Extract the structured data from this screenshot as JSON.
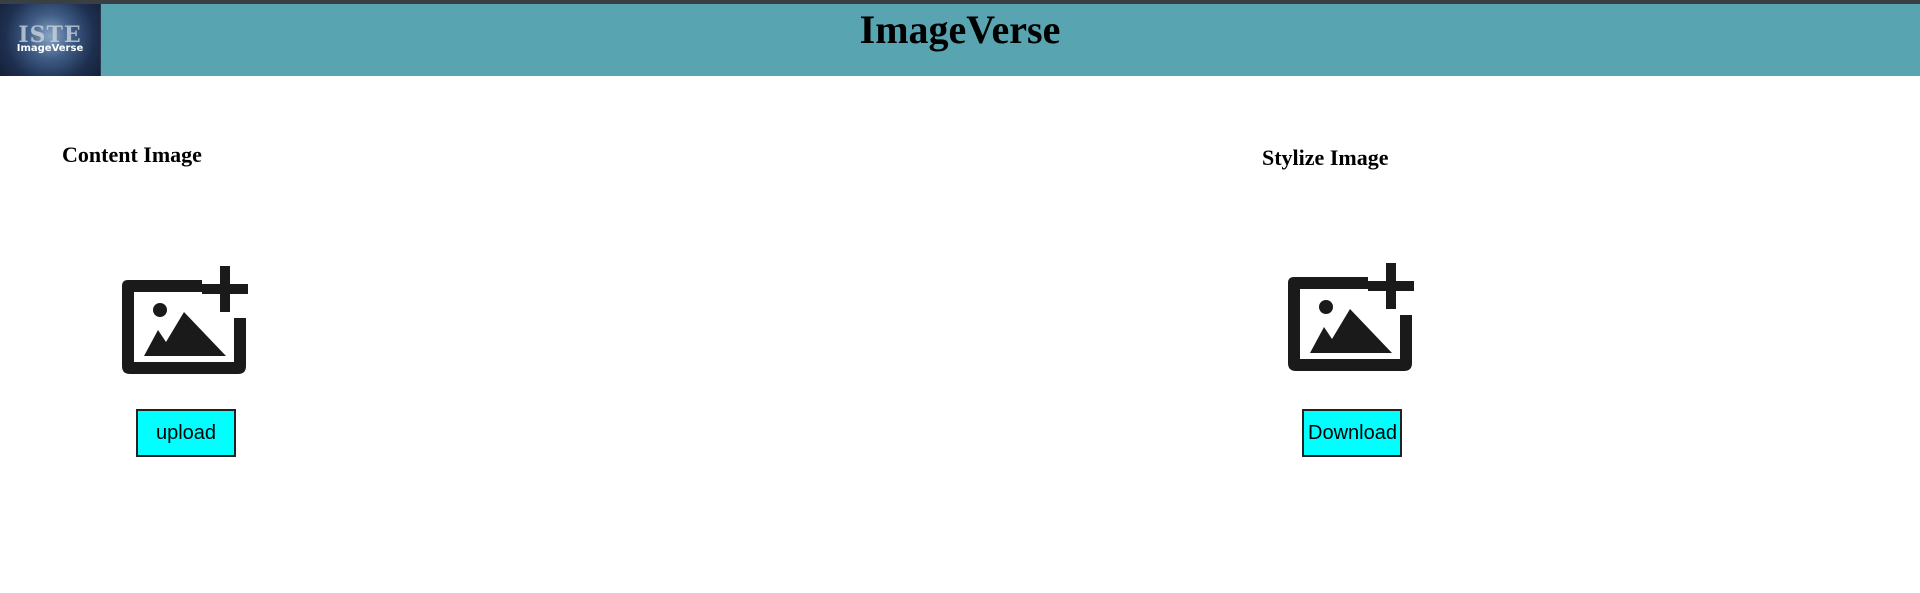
{
  "header": {
    "title": "ImageVerse",
    "logo": {
      "line1": "ISTE",
      "line2": "ImageVerse"
    },
    "background_color": "#58a5b1"
  },
  "panels": {
    "content": {
      "title": "Content Image",
      "icon": "add-photo-icon",
      "button_label": "upload"
    },
    "stylize": {
      "title": "Stylize Image",
      "icon": "add-photo-icon",
      "button_label": "Download"
    }
  },
  "colors": {
    "button_bg": "#00ffff",
    "icon": "#1a1a1a"
  }
}
